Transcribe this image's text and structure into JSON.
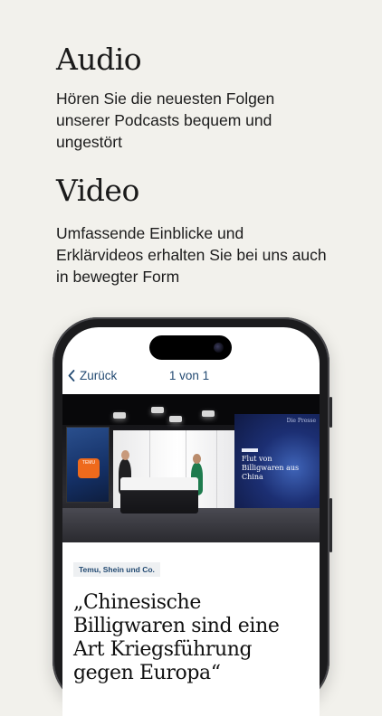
{
  "audio": {
    "title": "Audio",
    "description": "Hören Sie die neuesten Folgen unserer Podcasts bequem und ungestört"
  },
  "video": {
    "title": "Video",
    "description": "Umfassende Einblicke und Erklärvideos erhalten Sie bei uns auch in bewegter Form"
  },
  "phone": {
    "nav": {
      "back_label": "Zurück",
      "page_counter": "1 von 1"
    },
    "video_frame": {
      "left_screen_logo": "TEMU",
      "right_screen_watermark": "Die Presse",
      "right_screen_headline": "Flut von Billigwaren aus China"
    },
    "article": {
      "tag": "Temu, Shein und Co.",
      "headline": "„Chinesische Billigwaren sind eine Art Kriegsführung gegen Europa“"
    }
  },
  "colors": {
    "background": "#f2f1ec",
    "accent": "#234a72",
    "phone_frame": "#1b1b1d"
  },
  "icons": [
    "chevron-left-icon",
    "camera-icon"
  ]
}
